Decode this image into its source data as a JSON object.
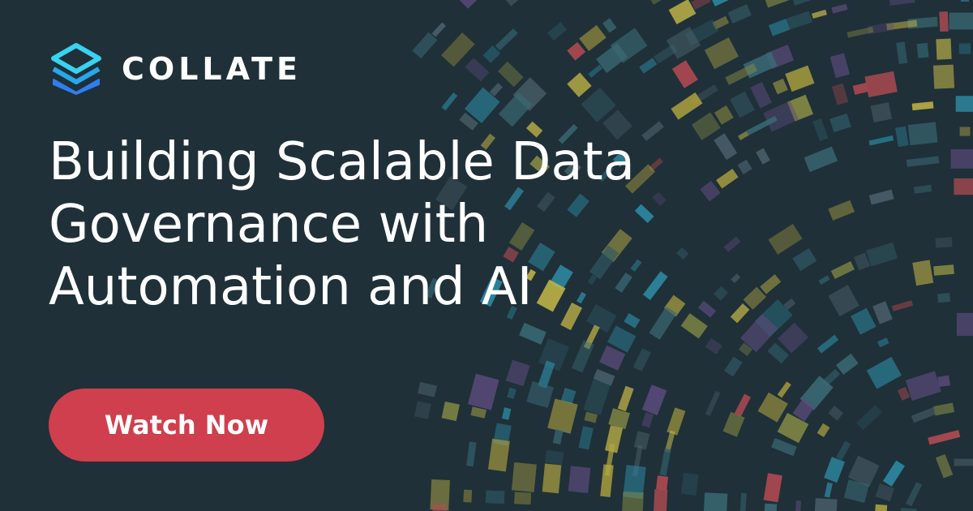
{
  "brand": {
    "name": "COLLATE",
    "logo_icon": "stacked-layers-icon",
    "logo_colors": [
      "#38d2f2",
      "#27a7ec",
      "#2f7ef0"
    ]
  },
  "headline": {
    "lines": [
      "Building Scalable Data",
      "Governance with",
      "Automation and AI"
    ]
  },
  "cta": {
    "label": "Watch Now",
    "color": "#cf3f4d"
  },
  "colors": {
    "background": "#1f3038",
    "tile_palette": [
      "#b4a63f",
      "#2d8aa4",
      "#4a5f6a",
      "#b74b52",
      "#3a6a74",
      "#8a8f45",
      "#5a4a7a",
      "#c2b447",
      "#2f5a66"
    ]
  }
}
